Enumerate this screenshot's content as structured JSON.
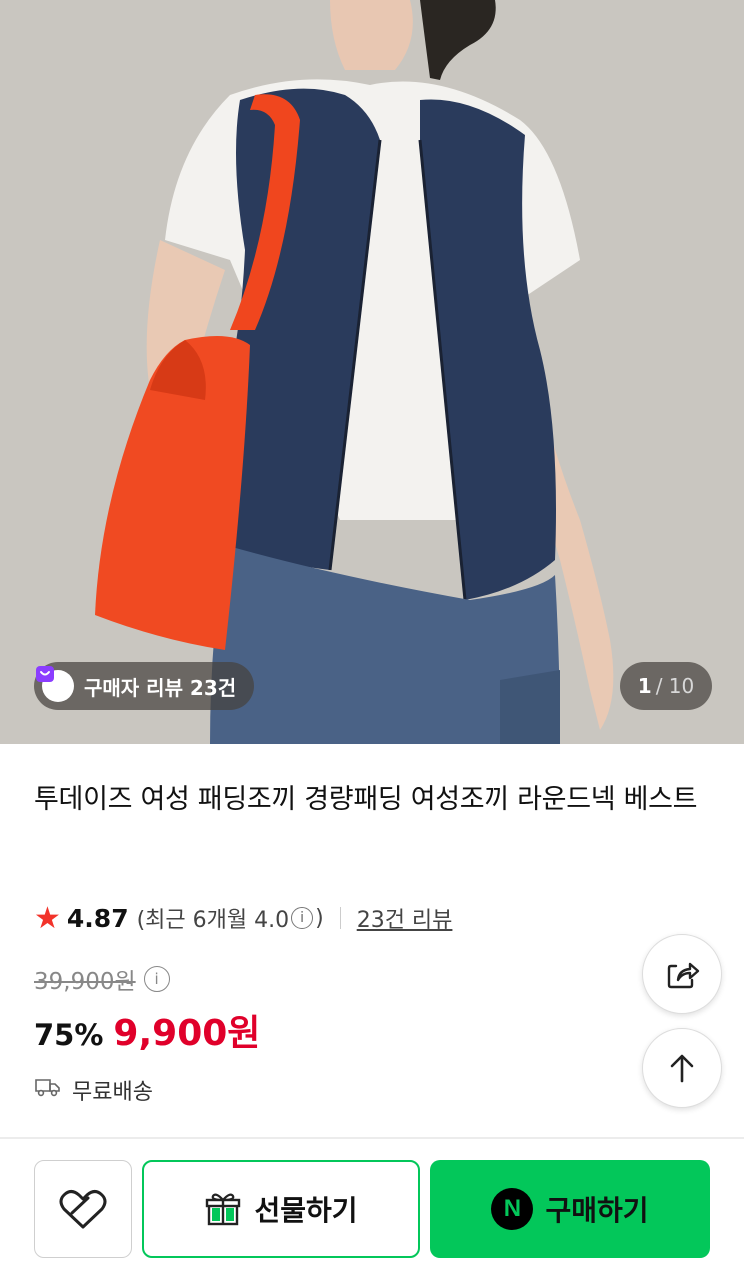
{
  "hero": {
    "image_label": "product-photo",
    "review_badge": "구매자 리뷰 23건",
    "page_current": "1",
    "page_total": "/ 10"
  },
  "product": {
    "title": "투데이즈 여성 패딩조끼 경량패딩 여성조끼 라운드넥 베스트",
    "rating_star": "★",
    "rating": "4.87",
    "rating_recent": "(최근 6개월 4.0",
    "rating_recent_close": ")",
    "info_glyph": "i",
    "reviews_link": "23건 리뷰",
    "original_price": "39,900원",
    "discount": "75%",
    "price": "9,900원",
    "shipping": "무료배송"
  },
  "actions": {
    "gift_label": "선물하기",
    "buy_label": "구매하기",
    "npay_letter": "N"
  },
  "colors": {
    "accent_green": "#03c75a",
    "price_red": "#e0002a",
    "star_red": "#f2332a"
  },
  "icons": [
    "bag-icon",
    "info-icon",
    "share-icon",
    "arrow-up-icon",
    "truck-icon",
    "heart-icon",
    "gift-icon",
    "npay-icon"
  ]
}
